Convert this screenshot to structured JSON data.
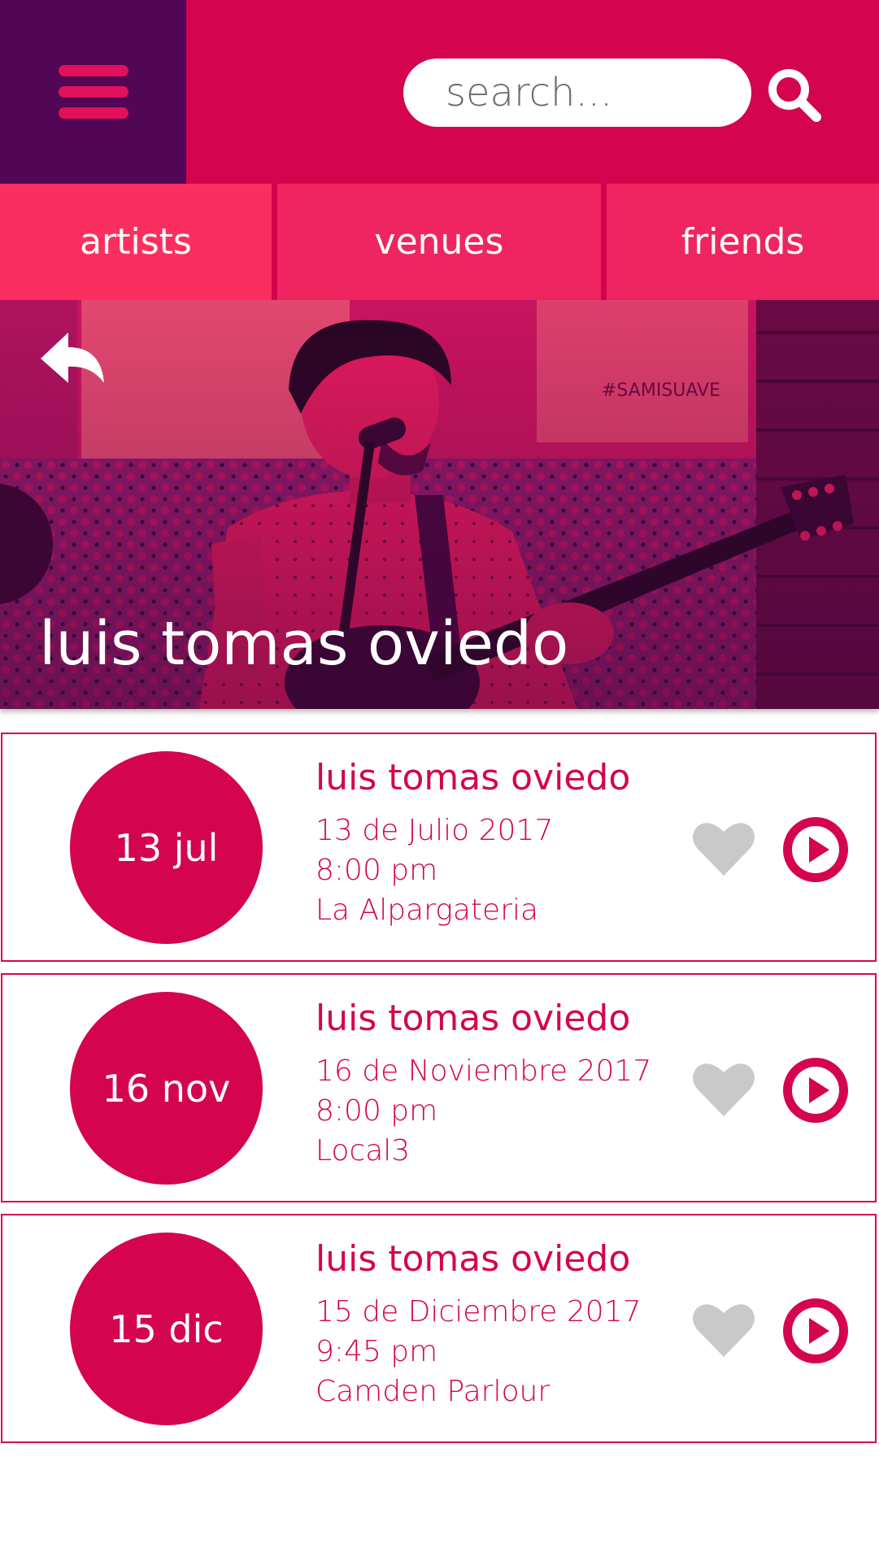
{
  "header": {
    "search_placeholder": "search...",
    "menu_icon": "hamburger-menu-icon",
    "search_icon": "search-icon"
  },
  "tabs": [
    {
      "label": "artists"
    },
    {
      "label": "venues"
    },
    {
      "label": "friends"
    }
  ],
  "hero": {
    "title": "luis tomas oviedo",
    "back_icon": "back-arrow-icon"
  },
  "events": [
    {
      "date_badge": "13 jul",
      "title": "luis tomas oviedo",
      "date_long": "13 de Julio 2017",
      "time": "8:00 pm",
      "venue": "La Alpargateria"
    },
    {
      "date_badge": "16 nov",
      "title": "luis tomas oviedo",
      "date_long": "16 de Noviembre 2017",
      "time": "8:00 pm",
      "venue": "Local3"
    },
    {
      "date_badge": "15 dic",
      "title": "luis tomas oviedo",
      "date_long": "15 de Diciembre 2017",
      "time": "9:45 pm",
      "venue": "Camden Parlour"
    }
  ],
  "colors": {
    "brand": "#d4044f",
    "menu_bg": "#520656",
    "tab_active": "#fb2f5f",
    "tab": "#ee2560",
    "heart": "#c9c9c9"
  }
}
